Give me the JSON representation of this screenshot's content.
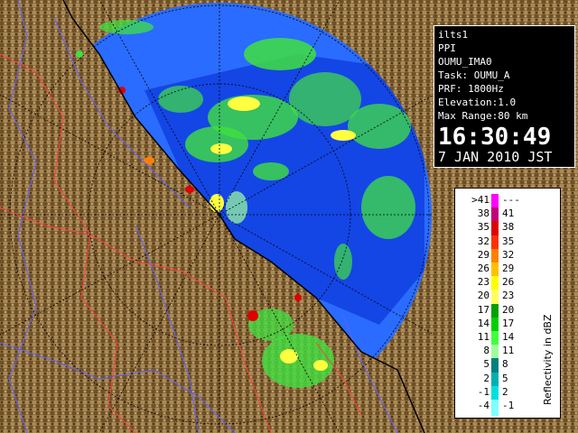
{
  "info": {
    "site": "ilts1",
    "scan": "PPI",
    "product": "OUMU_IMA0",
    "task": "Task: OUMU_A",
    "prf": "PRF: 1800Hz",
    "elevation": "Elevation:1.0",
    "max_range": "Max Range:80 km",
    "time": "16:30:49",
    "date": "7 JAN 2010 JST"
  },
  "legend": {
    "unit": "Reflectivity in dBZ",
    "rows": [
      {
        "left": ">41",
        "right": "---",
        "color": "#ff00ff"
      },
      {
        "left": "38",
        "right": "41",
        "color": "#c0007a"
      },
      {
        "left": "35",
        "right": "38",
        "color": "#e00000"
      },
      {
        "left": "32",
        "right": "35",
        "color": "#ff3000"
      },
      {
        "left": "29",
        "right": "32",
        "color": "#ff8000"
      },
      {
        "left": "26",
        "right": "29",
        "color": "#ffc000"
      },
      {
        "left": "23",
        "right": "26",
        "color": "#ffff00"
      },
      {
        "left": "20",
        "right": "23",
        "color": "#ffff60"
      },
      {
        "left": "17",
        "right": "20",
        "color": "#00a000"
      },
      {
        "left": "14",
        "right": "17",
        "color": "#00d000"
      },
      {
        "left": "11",
        "right": "14",
        "color": "#40ff40"
      },
      {
        "left": "8",
        "right": "11",
        "color": "#a0ffa0"
      },
      {
        "left": "5",
        "right": "8",
        "color": "#008080"
      },
      {
        "left": "2",
        "right": "5",
        "color": "#00b0b0"
      },
      {
        "left": "-1",
        "right": "2",
        "color": "#00e0e0"
      },
      {
        "left": "-4",
        "right": "-1",
        "color": "#80ffff"
      }
    ]
  },
  "colors": {
    "sea_outer": "#2a6cff",
    "sea_inner": "#1040e0",
    "land": "#8a6a3a",
    "echo_green": "#40e040",
    "echo_yellow": "#ffff40",
    "echo_red": "#e00000",
    "border_line": "#ff4040",
    "river_line": "#6060ff"
  }
}
